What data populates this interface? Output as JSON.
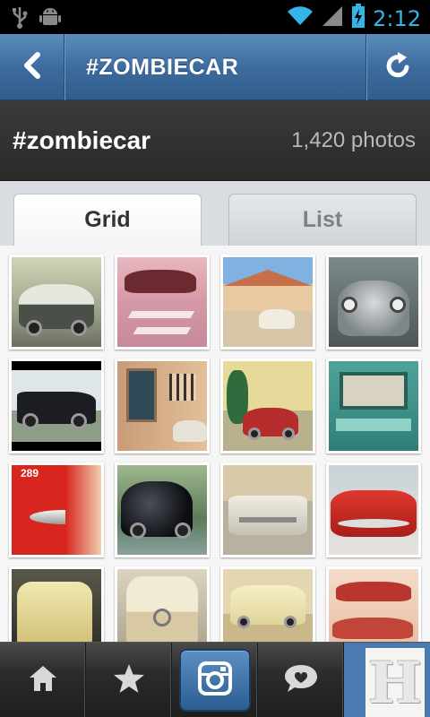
{
  "status_bar": {
    "time": "2:12",
    "icons": [
      "usb-icon",
      "android-debug-icon",
      "wifi-icon",
      "signal-icon",
      "battery-charging-icon"
    ],
    "accent": "#33b5e5"
  },
  "title_bar": {
    "title": "#ZOMBIECAR",
    "back_icon": "chevron-left-icon",
    "refresh_icon": "refresh-icon",
    "color": "#3b6a9c"
  },
  "tag_header": {
    "tag": "#zombiecar",
    "count": "1,420 photos"
  },
  "tabs": [
    {
      "label": "Grid",
      "selected": true
    },
    {
      "label": "List",
      "selected": false
    }
  ],
  "grid": {
    "photos": [
      {
        "subject": "vw-bus-photo"
      },
      {
        "subject": "studebaker-parking-photo"
      },
      {
        "subject": "driveway-car-photo"
      },
      {
        "subject": "vw-beetle-front-photo"
      },
      {
        "subject": "black-pickup-photo"
      },
      {
        "subject": "doorway-car-photo"
      },
      {
        "subject": "red-beetle-photo"
      },
      {
        "subject": "teal-truck-photo"
      },
      {
        "subject": "red-fin-photo"
      },
      {
        "subject": "black-beetle-photo"
      },
      {
        "subject": "white-chevy-photo"
      },
      {
        "subject": "red-belair-photo"
      },
      {
        "subject": "yellow-bus-photo"
      },
      {
        "subject": "vw-bus-front-photo"
      },
      {
        "subject": "cream-van-photo"
      },
      {
        "subject": "red-cars-photo"
      }
    ]
  },
  "bottom_nav": {
    "items": [
      "home-icon",
      "star-icon",
      "camera-icon",
      "news-bubble-icon",
      "profile-avatar"
    ],
    "active": "camera-icon",
    "avatar_letter": "H"
  }
}
